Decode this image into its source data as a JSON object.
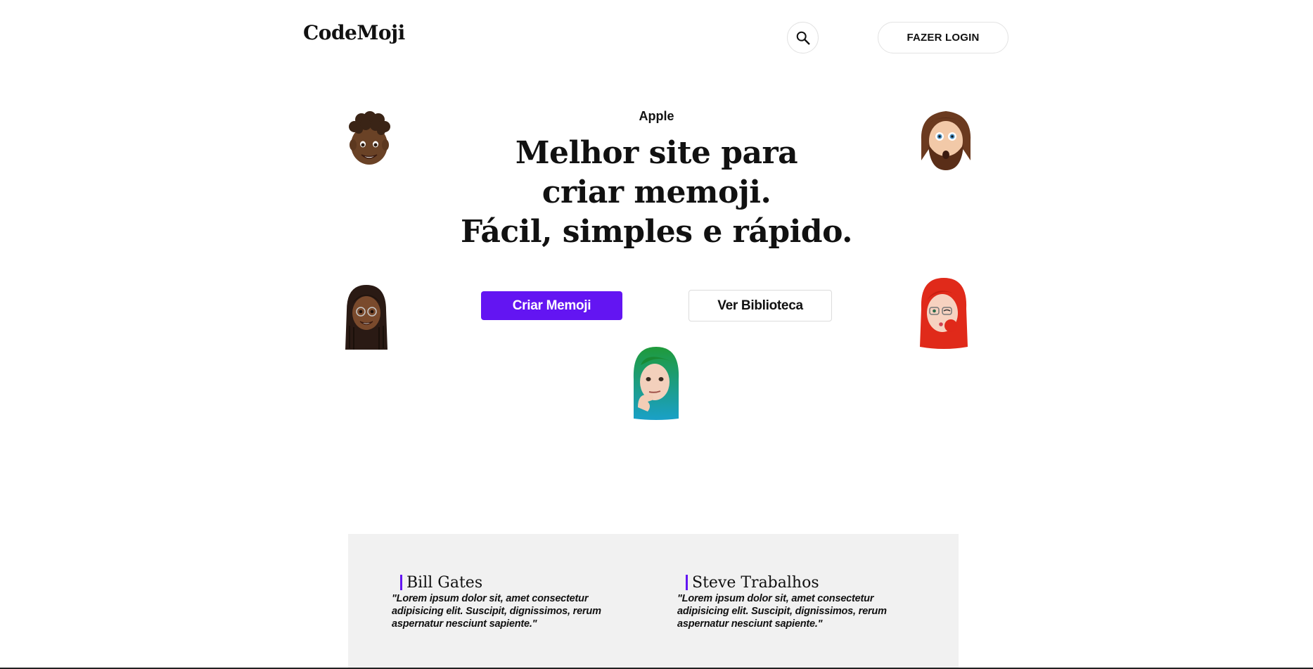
{
  "header": {
    "logo": "CodeMoji",
    "search_icon": "search-icon",
    "login_label": "FAZER LOGIN"
  },
  "hero": {
    "eyebrow": "Apple",
    "headline": [
      "Melhor site para",
      "criar memoji.",
      "Fácil, simples e rápido."
    ],
    "primary_label": "Criar Memoji",
    "secondary_label": "Ver Biblioteca"
  },
  "memojis": [
    "memoji-curly-hair-boy",
    "memoji-bearded-man",
    "memoji-braids-woman",
    "memoji-red-hair-woman",
    "memoji-green-hair-thinking"
  ],
  "testimonials": [
    {
      "name": "Bill Gates",
      "quote": "\"Lorem ipsum dolor sit, amet consectetur adipisicing elit. Suscipit, dignissimos, rerum aspernatur nesciunt sapiente.\""
    },
    {
      "name": "Steve Trabalhos",
      "quote": "\"Lorem ipsum dolor sit, amet consectetur adipisicing elit. Suscipit, dignissimos, rerum aspernatur nesciunt sapiente.\""
    }
  ],
  "colors": {
    "accent": "#6315f2",
    "section_bg": "#f1f1f1"
  }
}
